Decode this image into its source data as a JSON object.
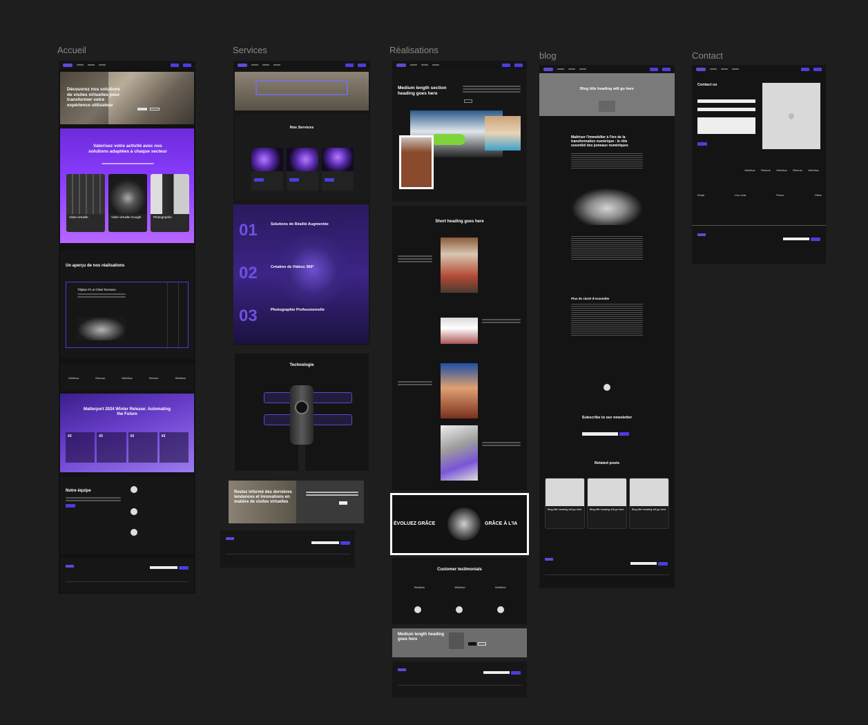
{
  "frames": {
    "accueil": {
      "label": "Accueil"
    },
    "services": {
      "label": "Services"
    },
    "realisations": {
      "label": "Réalisations"
    },
    "blog": {
      "label": "blog"
    },
    "contact": {
      "label": "Contact"
    }
  },
  "accueil": {
    "hero_title": "Découvrez nos solutions de visites virtuelles pour transformer votre expérience utilisateur",
    "sector_title": "Valorisez votre activité avec nos solutions adaptées à chaque secteur",
    "sector_cards": [
      "Visite virtuelle",
      "Visite virtuelle Google",
      "Photographie"
    ],
    "apercu_title": "Un aperçu de nos réalisations",
    "apercu_item": "Tiliplan P1 & Clisel Romano",
    "release_title": "Matterport 2024 Winter Release: Automating the Future",
    "release_nums": [
      "#3",
      "#3",
      "#3",
      "#3"
    ],
    "team_title": "Notre équipe"
  },
  "services": {
    "services_title": "Nos Services",
    "items": [
      {
        "num": "01",
        "title": "Solutions de Réalité Augmentée"
      },
      {
        "num": "02",
        "title": "Création de Vidéos 360°"
      },
      {
        "num": "03",
        "title": "Photographie Professionnelle"
      }
    ],
    "tech_title": "Technologie",
    "cta_title": "Restez informé des dernières tendances et innovations en matière de visites virtuelles"
  },
  "realisations": {
    "hero_title": "Medium length section heading goes here",
    "short_title": "Short heading goes here",
    "banner_left": "ÉVOLUEZ GRÂCE",
    "banner_right": "GRÂCE À L'IA",
    "testimonials_title": "Customer testimonials",
    "cta_title": "Medium length heading goes here"
  },
  "blog": {
    "hero_title": "Blog title heading will go here",
    "article_title": "Maîtriser l'immobilier à l'ère de la transformation numérique : le rôle essentiel des jumeaux numériques",
    "section_heading": "Plus de clarté d'ensemble",
    "newsletter_title": "Subscribe to our newsletter",
    "related_title": "Related posts",
    "related_cards": [
      "Blog title heading will go here",
      "Blog title heading will go here",
      "Blog title heading will go here"
    ]
  },
  "contact": {
    "form_title": "Contact us",
    "info": [
      "Email",
      "Live chat",
      "Phone",
      "Office"
    ]
  },
  "logos": [
    "Webflow",
    "Relume",
    "Webflow",
    "Relume",
    "Webflow"
  ],
  "colors": {
    "accent": "#4a3ee0",
    "purple": "#8a3dff",
    "bg": "#121212",
    "canvas": "#1e1e1e"
  }
}
